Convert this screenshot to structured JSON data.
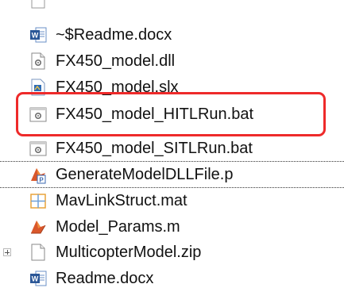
{
  "files": [
    {
      "name": "~$Readme.docx",
      "icon": "word-doc-icon"
    },
    {
      "name": "FX450_model.dll",
      "icon": "dll-file-icon"
    },
    {
      "name": "FX450_model.slx",
      "icon": "simulink-model-icon"
    },
    {
      "name": "FX450_model_HITLRun.bat",
      "icon": "batch-file-icon"
    },
    {
      "name": "FX450_model_SITLRun.bat",
      "icon": "batch-file-icon"
    },
    {
      "name": "GenerateModelDLLFile.p",
      "icon": "matlab-p-file-icon"
    },
    {
      "name": "MavLinkStruct.mat",
      "icon": "mat-data-icon"
    },
    {
      "name": "Model_Params.m",
      "icon": "matlab-m-file-icon"
    },
    {
      "name": "MulticopterModel.zip",
      "icon": "blank-file-icon"
    },
    {
      "name": "Readme.docx",
      "icon": "word-doc-icon"
    }
  ],
  "highlight_color": "#ee2a2a"
}
